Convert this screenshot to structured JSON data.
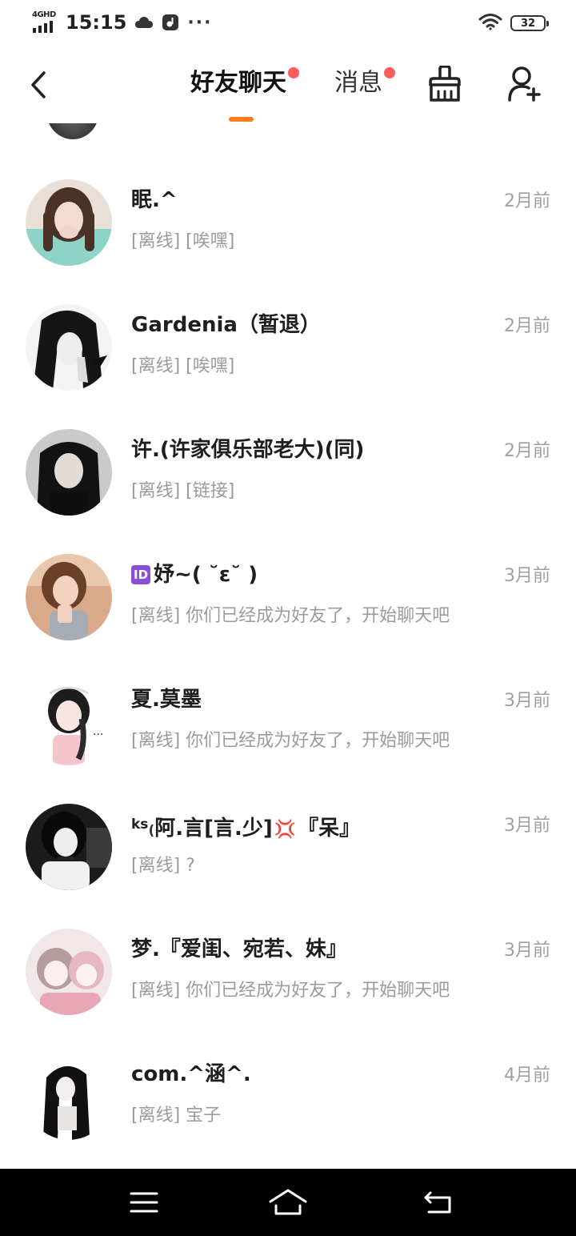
{
  "status_bar": {
    "network": "4GHD",
    "time": "15:15",
    "more": "···",
    "battery": "32"
  },
  "header": {
    "tabs": [
      {
        "label": "好友聊天",
        "active": true,
        "has_dot": true
      },
      {
        "label": "消息",
        "active": false,
        "has_dot": true
      }
    ],
    "accent_color": "#ff7f1f",
    "dot_color": "#ff5c5c"
  },
  "chats": [
    {
      "name": "眠.^",
      "preview": "[离线] [唉嘿]",
      "time": "2月前"
    },
    {
      "name": "Gardenia（暂退）",
      "preview": "[离线] [唉嘿]",
      "time": "2月前"
    },
    {
      "name": "许.(许家俱乐部老大)(同)",
      "preview": "[离线] [链接]",
      "time": "2月前"
    },
    {
      "name_badge": "ID",
      "name": "妤~( ˘ε˘ )",
      "preview": "[离线] 你们已经成为好友了，开始聊天吧",
      "time": "3月前"
    },
    {
      "name": "夏.莫墨",
      "preview": "[离线] 你们已经成为好友了，开始聊天吧",
      "time": "3月前"
    },
    {
      "name_prefix": "ks",
      "name_main": "阿.言[言.少]",
      "name_suffix": "『呆』",
      "preview": "[离线] ?",
      "time": "3月前"
    },
    {
      "name": "梦.『爱闺、宛若、妹』",
      "preview": "[离线] 你们已经成为好友了，开始聊天吧",
      "time": "3月前"
    },
    {
      "name": "com.^涵^.",
      "preview": "[离线] 宝子",
      "time": "4月前"
    }
  ]
}
